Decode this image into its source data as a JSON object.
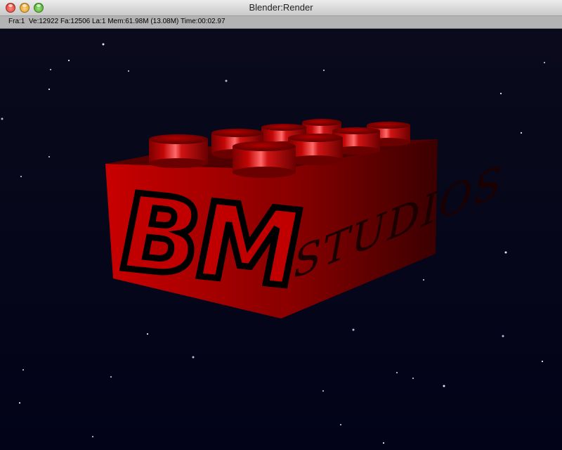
{
  "window": {
    "title": "Blender:Render"
  },
  "statusbar": {
    "text": "Fra:1  Ve:12922 Fa:12506 La:1 Mem:61.98M (13.08M) Time:00:02.97"
  },
  "render": {
    "brick_color": "#b00000",
    "background_color": "#050518",
    "logo_text": "BM",
    "side_text": "STUDIOS"
  }
}
